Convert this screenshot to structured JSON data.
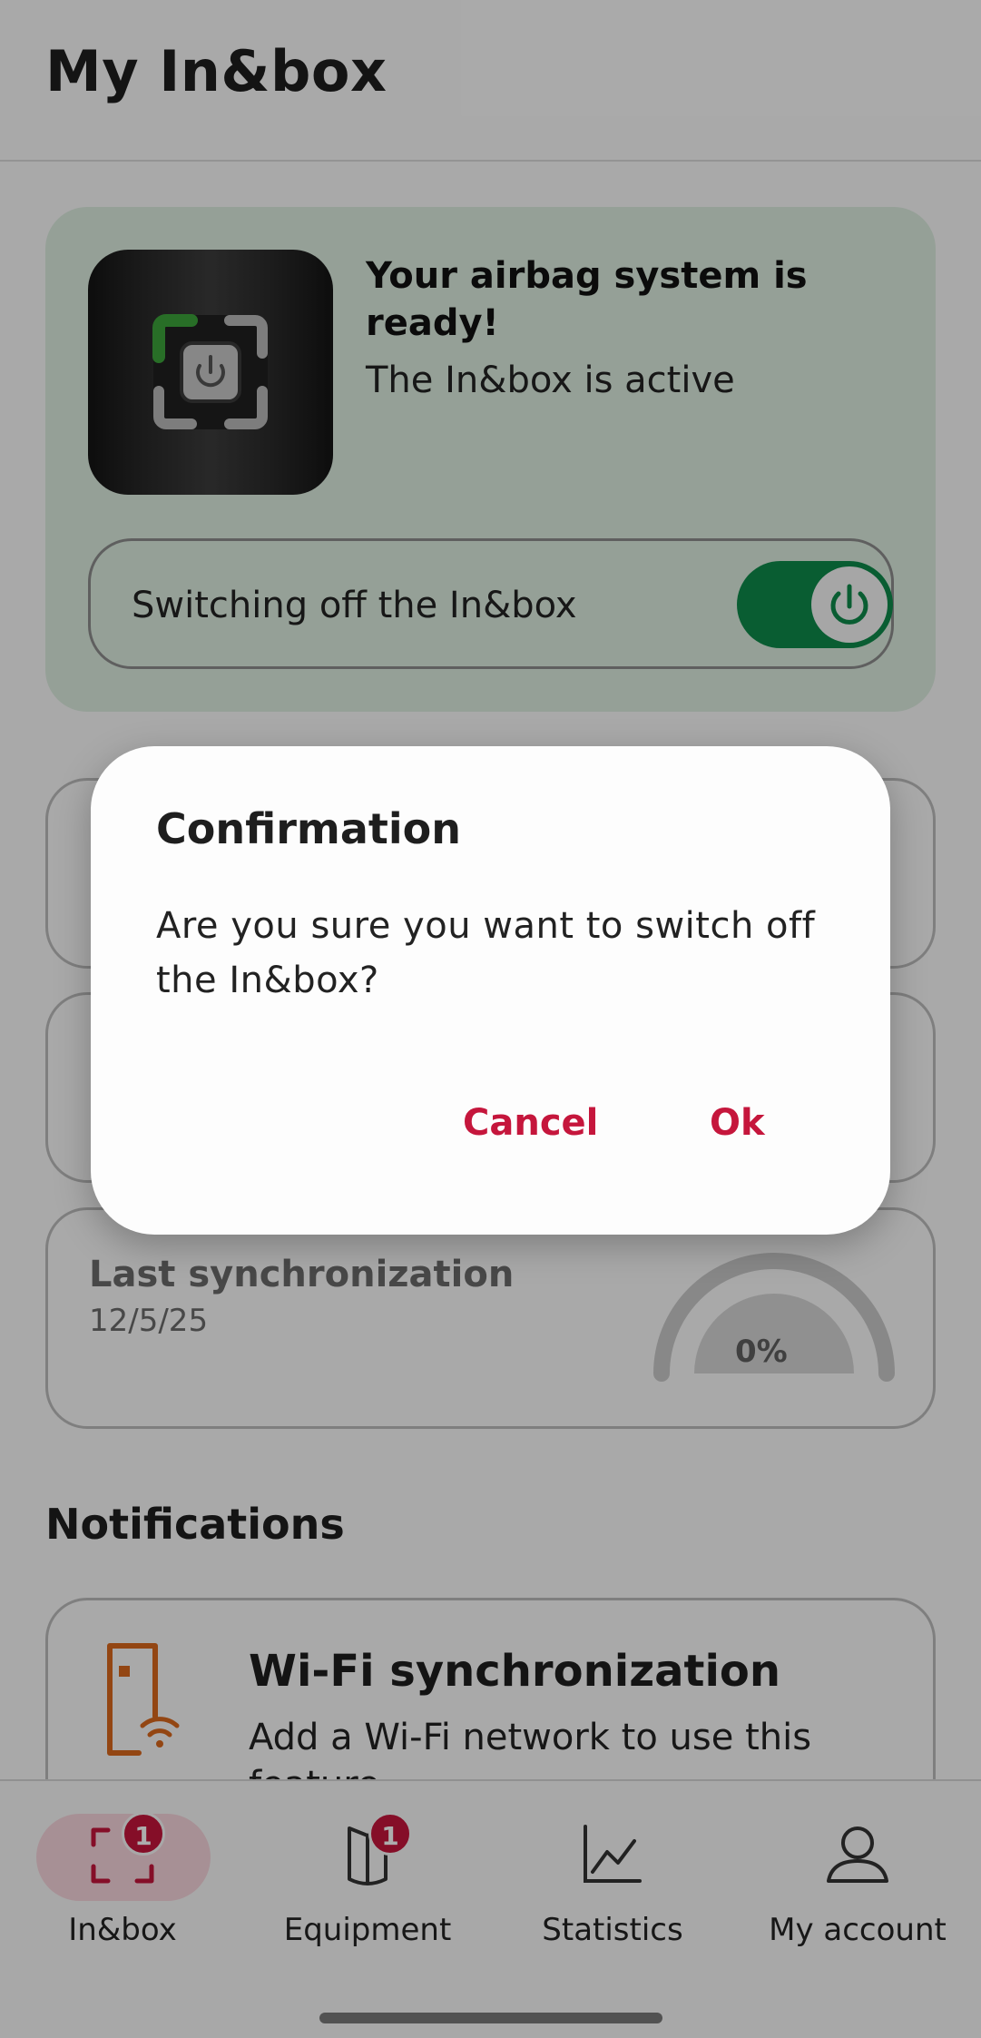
{
  "header": {
    "title": "My In&box"
  },
  "status_card": {
    "title": "Your airbag system is ready!",
    "subtitle": "The In&box is active",
    "switch_label": "Switching off the In&box",
    "switch_on": true,
    "background_color": "#dcecdf",
    "toggle_color": "#0e8a4a"
  },
  "sync": {
    "title": "Last synchronization",
    "date": "12/5/25",
    "gauge_value": "0%"
  },
  "notifications": {
    "section_title": "Notifications",
    "items": [
      {
        "icon": "door-wifi-icon",
        "title": "Wi-Fi synchronization",
        "text": "Add a Wi-Fi network to use this feature"
      }
    ]
  },
  "nav": {
    "items": [
      {
        "label": "In&box",
        "icon": "inbox-frame-icon",
        "badge": "1",
        "active": true
      },
      {
        "label": "Equipment",
        "icon": "equipment-icon",
        "badge": "1",
        "active": false
      },
      {
        "label": "Statistics",
        "icon": "chart-icon",
        "active": false
      },
      {
        "label": "My account",
        "icon": "user-icon",
        "active": false
      }
    ]
  },
  "dialog": {
    "title": "Confirmation",
    "message": "Are you sure you want to switch off the In&box?",
    "cancel_label": "Cancel",
    "ok_label": "Ok"
  },
  "colors": {
    "accent": "#c5163c",
    "active_green": "#0e8a4a"
  }
}
